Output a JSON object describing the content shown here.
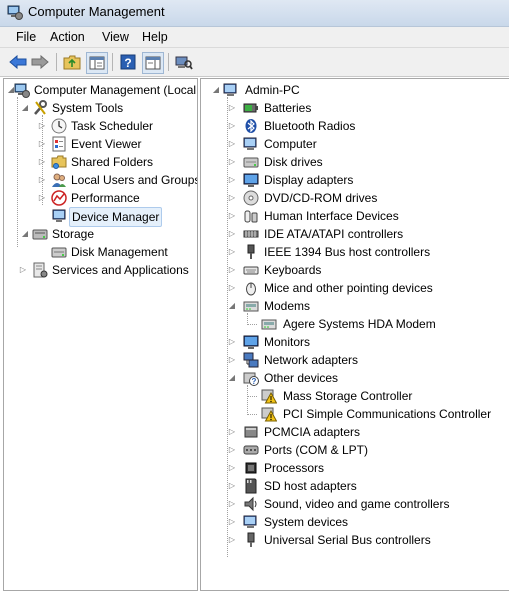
{
  "window": {
    "title": "Computer Management"
  },
  "menu": {
    "file": "File",
    "action": "Action",
    "view": "View",
    "help": "Help"
  },
  "left_tree": {
    "root": "Computer Management (Local",
    "system_tools": "System Tools",
    "task_scheduler": "Task Scheduler",
    "event_viewer": "Event Viewer",
    "shared_folders": "Shared Folders",
    "local_users": "Local Users and Groups",
    "performance": "Performance",
    "device_manager": "Device Manager",
    "storage": "Storage",
    "disk_management": "Disk Management",
    "services": "Services and Applications"
  },
  "right_tree": {
    "root": "Admin-PC",
    "items": [
      "Batteries",
      "Bluetooth Radios",
      "Computer",
      "Disk drives",
      "Display adapters",
      "DVD/CD-ROM drives",
      "Human Interface Devices",
      "IDE ATA/ATAPI controllers",
      "IEEE 1394 Bus host controllers",
      "Keyboards",
      "Mice and other pointing devices",
      "Modems",
      "Agere Systems HDA Modem",
      "Monitors",
      "Network adapters",
      "Other devices",
      "Mass Storage Controller",
      "PCI Simple Communications Controller",
      "PCMCIA adapters",
      "Ports (COM & LPT)",
      "Processors",
      "SD host adapters",
      "Sound, video and game controllers",
      "System devices",
      "Universal Serial Bus controllers"
    ]
  }
}
